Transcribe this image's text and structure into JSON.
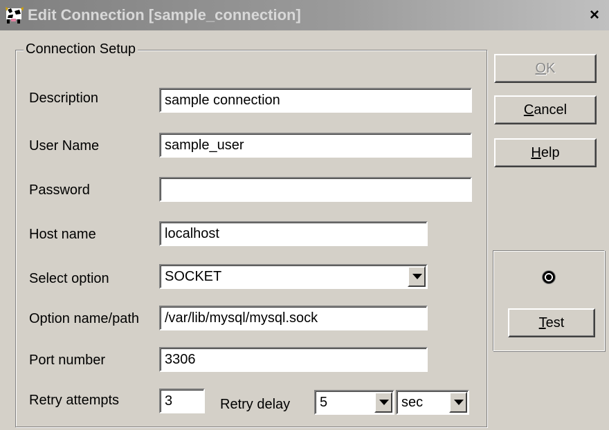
{
  "window": {
    "title": "Edit Connection [sample_connection]",
    "close_label": "×",
    "app_icon": "cow-icon"
  },
  "group": {
    "label": "Connection Setup"
  },
  "fields": {
    "description": {
      "label": "Description",
      "value": "sample connection"
    },
    "user_name": {
      "label": "User Name",
      "value": "sample_user"
    },
    "password": {
      "label": "Password",
      "value": ""
    },
    "host_name": {
      "label": "Host name",
      "value": "localhost"
    },
    "select_option": {
      "label": "Select option",
      "value": "SOCKET"
    },
    "option_path": {
      "label": "Option name/path",
      "value": "/var/lib/mysql/mysql.sock"
    },
    "port_number": {
      "label": "Port number",
      "value": "3306"
    },
    "retry_attempts": {
      "label": "Retry attempts",
      "value": "3"
    },
    "retry_delay": {
      "label": "Retry delay",
      "value": "5",
      "unit": "sec"
    }
  },
  "buttons": {
    "ok": {
      "mnemonic": "O",
      "rest": "K",
      "enabled": false
    },
    "cancel": {
      "mnemonic": "C",
      "rest": "ancel"
    },
    "help": {
      "mnemonic": "H",
      "rest": "elp"
    },
    "test": {
      "mnemonic": "T",
      "rest": "est"
    }
  },
  "colors": {
    "face": "#d4d0c8",
    "titlebar_inactive": "#808080"
  }
}
